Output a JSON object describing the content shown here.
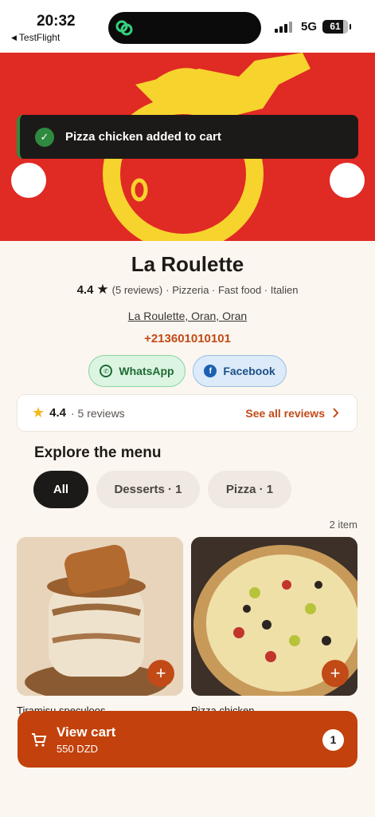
{
  "status_bar": {
    "time": "20:32",
    "back_app": "TestFlight",
    "network": "5G",
    "battery": "61"
  },
  "toast": {
    "message": "Pizza chicken added to cart"
  },
  "restaurant": {
    "name": "La Roulette",
    "rating": "4.4",
    "reviews_count": "(5 reviews)",
    "categories": "· Pizzeria · Fast food · Italien",
    "address": "La Roulette, Oran, Oran",
    "phone": "+213601010101"
  },
  "social": {
    "whatsapp": "WhatsApp",
    "facebook": "Facebook"
  },
  "reviews_card": {
    "rating": "4.4",
    "count": "· 5 reviews",
    "see_all": "See all reviews"
  },
  "menu": {
    "heading": "Explore the menu",
    "filters": [
      {
        "label": "All",
        "active": true
      },
      {
        "label": "Desserts · 1",
        "active": false
      },
      {
        "label": "Pizza · 1",
        "active": false
      }
    ],
    "count_label": "2 item",
    "items": [
      {
        "name": "Tiramisu speculoos",
        "add": "+"
      },
      {
        "name": "Pizza chicken",
        "add": "+"
      }
    ]
  },
  "cart": {
    "title": "View cart",
    "total": "550 DZD",
    "badge": "1"
  },
  "colors": {
    "brand_orange": "#c2410c",
    "hero_red": "#e02a24",
    "hero_yellow": "#f7d32e",
    "success_green": "#2e8a3f"
  },
  "icons": [
    "back-arrow-icon",
    "island-app-icon",
    "signal-icon",
    "check-icon",
    "star-icon",
    "whatsapp-icon",
    "facebook-icon",
    "chevron-right-icon",
    "plus-icon",
    "cart-icon"
  ]
}
